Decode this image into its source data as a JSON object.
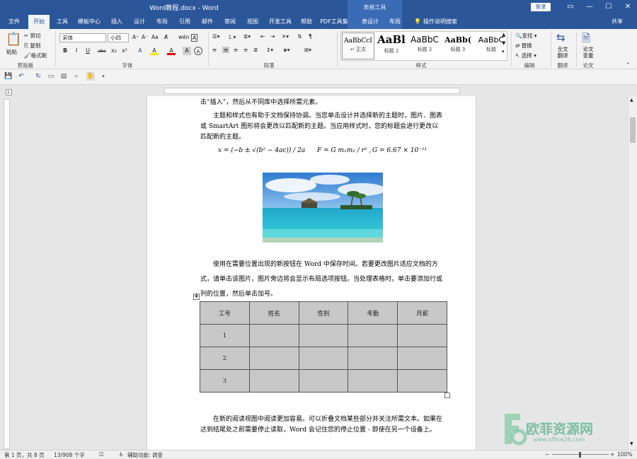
{
  "titlebar": {
    "title": "Word教程.docx - Word",
    "context_header": "表格工具",
    "login": "登录",
    "win": [
      "▭",
      "—",
      "☐",
      "✕"
    ]
  },
  "tabs": [
    "文件",
    "开始",
    "工具",
    "模板中心",
    "插入",
    "设计",
    "布局",
    "引用",
    "邮件",
    "审阅",
    "视图",
    "开发工具",
    "帮助",
    "PDF工具集",
    "表设计",
    "布局",
    "操作说明搜索",
    "共享"
  ],
  "ribbon": {
    "clipboard": {
      "paste": "粘贴",
      "cut": "剪切",
      "copy": "复制",
      "format_painter": "格式刷",
      "label": "剪贴板"
    },
    "font": {
      "name": "宋体",
      "size": "小四",
      "label": "字体",
      "buttons": [
        "B",
        "I",
        "U",
        "abc",
        "x₂",
        "x²",
        "A",
        "A",
        "A",
        "A",
        "Aa",
        "A",
        "wén",
        "A"
      ]
    },
    "paragraph": {
      "label": "段落"
    },
    "styles": {
      "label": "样式",
      "items": [
        {
          "sample": "AaBbCcI",
          "name": "↵ 正文"
        },
        {
          "sample": "AaBl",
          "name": "标题 1"
        },
        {
          "sample": "AaBbC",
          "name": "标题 2"
        },
        {
          "sample": "AaBb(",
          "name": "标题 3"
        },
        {
          "sample": "AaBbC",
          "name": "标题"
        }
      ]
    },
    "editing": {
      "find": "查找",
      "replace": "替换",
      "select": "选择",
      "label": "编辑"
    },
    "translate": {
      "btn": "全文翻译",
      "label": "翻译"
    },
    "paper": {
      "btn": "论文查重",
      "label": "论文"
    }
  },
  "document": {
    "line1": "击“插入”，然后从不同库中选择所需元素。",
    "para1": "主题和样式也有助于文档保持协调。当您单击设计并选择新的主题时，图片、图表或 SmartArt 图形将会更改以匹配新的主题。当应用样式时，您的标题会进行更改以匹配新的主题。",
    "eq1": "x = (−b ± √(b² − 4ac)) / 2a",
    "eq2": "F = G m₁m₂ / r² ,",
    "eq3": "G = 6.67 × 10⁻¹¹",
    "para2": "使用在需要位置出现的新按钮在 Word 中保存时间。若要更改图片适应文档的方式，请单击该图片，图片旁边将会显示布局选项按钮。当处理表格时，单击要添加行或列的位置，然后单击加号。",
    "table": {
      "headers": [
        "工号",
        "姓名",
        "性别",
        "考勤",
        "月薪"
      ],
      "rows": [
        [
          "1",
          "",
          "",
          "",
          ""
        ],
        [
          "2",
          "",
          "",
          "",
          ""
        ],
        [
          "3",
          "",
          "",
          "",
          ""
        ]
      ]
    },
    "para3": "在新的阅读视图中阅读更加容易。可以折叠文档某些部分并关注所需文本。如果在达到结尾处之前需要停止读取，Word 会记住您的停止位置 - 即使在另一个设备上。"
  },
  "status": {
    "page": "第 1 页，共 8 页",
    "words": "13/908 个字",
    "accessibility": "辅助功能: 调查",
    "zoom": "100%"
  },
  "watermark": {
    "cn": "欧菲资源网",
    "url": "www.office26.com"
  }
}
